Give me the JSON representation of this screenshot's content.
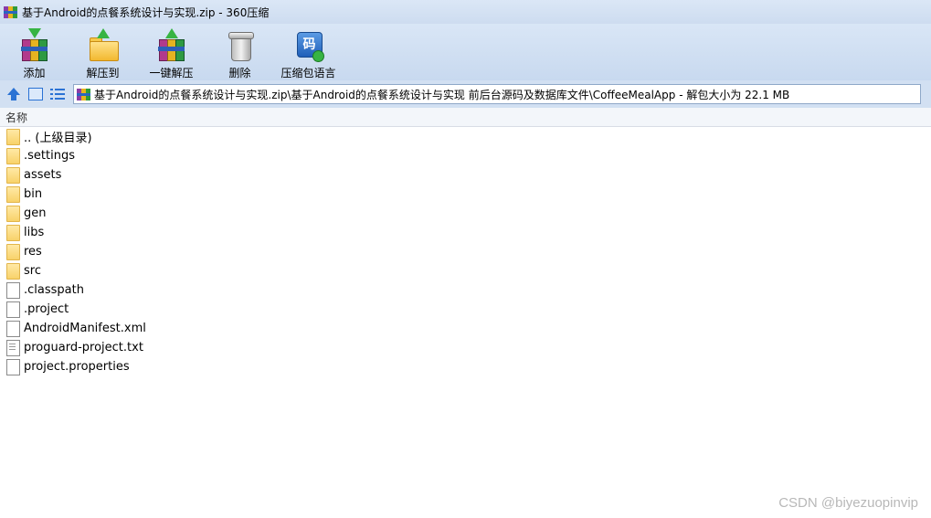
{
  "window": {
    "title": "基于Android的点餐系统设计与实现.zip - 360压缩"
  },
  "toolbar": {
    "add_label": "添加",
    "extract_to_label": "解压到",
    "one_click_label": "一键解压",
    "delete_label": "删除",
    "comment_label": "压缩包语言"
  },
  "address": {
    "path": "基于Android的点餐系统设计与实现.zip\\基于Android的点餐系统设计与实现 前后台源码及数据库文件\\CoffeeMealApp - 解包大小为 22.1 MB"
  },
  "list": {
    "header_name": "名称",
    "items": [
      {
        "name": ".. (上级目录)",
        "kind": "folder"
      },
      {
        "name": ".settings",
        "kind": "folder"
      },
      {
        "name": "assets",
        "kind": "folder"
      },
      {
        "name": "bin",
        "kind": "folder"
      },
      {
        "name": "gen",
        "kind": "folder"
      },
      {
        "name": "libs",
        "kind": "folder"
      },
      {
        "name": "res",
        "kind": "folder"
      },
      {
        "name": "src",
        "kind": "folder"
      },
      {
        "name": ".classpath",
        "kind": "file"
      },
      {
        "name": ".project",
        "kind": "file"
      },
      {
        "name": "AndroidManifest.xml",
        "kind": "file"
      },
      {
        "name": "proguard-project.txt",
        "kind": "text-file"
      },
      {
        "name": "project.properties",
        "kind": "file"
      }
    ]
  },
  "watermark": "CSDN @biyezuopinvip"
}
